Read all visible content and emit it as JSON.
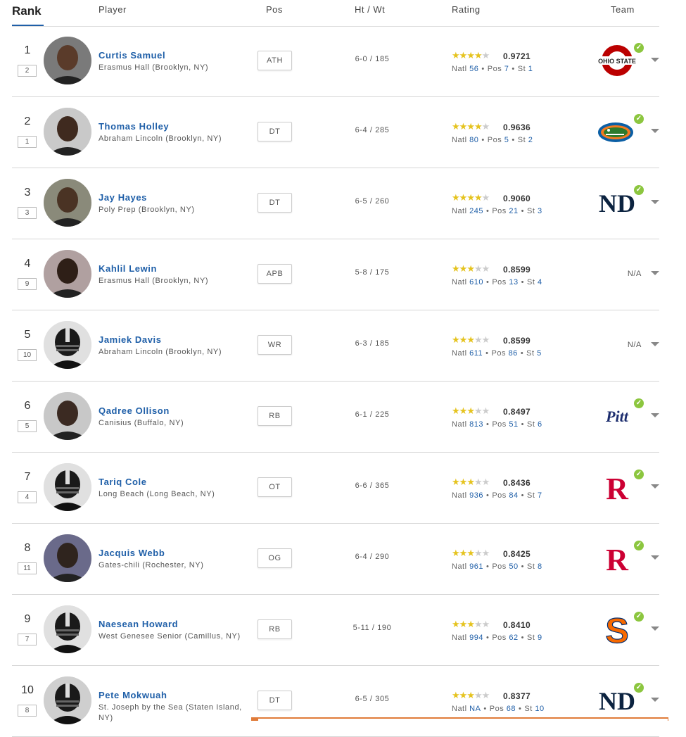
{
  "header": {
    "rank": "Rank",
    "player": "Player",
    "pos": "Pos",
    "htwt": "Ht / Wt",
    "rating": "Rating",
    "team": "Team"
  },
  "colors": {
    "accent": "#1f5fa8",
    "star": "#e5c31e",
    "check": "#8cc63f"
  },
  "players": [
    {
      "rank": "1",
      "prev": "2",
      "name": "Curtis Samuel",
      "school": "Erasmus Hall (Brooklyn, NY)",
      "pos": "ATH",
      "htwt": "6-0 / 185",
      "stars": 4,
      "score": "0.9721",
      "natl_label": "Natl",
      "natl": "56",
      "pos_label": "Pos",
      "posrank": "7",
      "st_label": "St",
      "st": "1",
      "team": "ohio-state-logo",
      "committed": true
    },
    {
      "rank": "2",
      "prev": "1",
      "name": "Thomas Holley",
      "school": "Abraham Lincoln (Brooklyn, NY)",
      "pos": "DT",
      "htwt": "6-4 / 285",
      "stars": 4,
      "score": "0.9636",
      "natl_label": "Natl",
      "natl": "80",
      "pos_label": "Pos",
      "posrank": "5",
      "st_label": "St",
      "st": "2",
      "team": "florida-gator-logo",
      "committed": true
    },
    {
      "rank": "3",
      "prev": "3",
      "name": "Jay Hayes",
      "school": "Poly Prep (Brooklyn, NY)",
      "pos": "DT",
      "htwt": "6-5 / 260",
      "stars": 4,
      "score": "0.9060",
      "natl_label": "Natl",
      "natl": "245",
      "pos_label": "Pos",
      "posrank": "21",
      "st_label": "St",
      "st": "3",
      "team": "notre-dame-logo",
      "committed": true
    },
    {
      "rank": "4",
      "prev": "9",
      "name": "Kahlil Lewin",
      "school": "Erasmus Hall (Brooklyn, NY)",
      "pos": "APB",
      "htwt": "5-8 / 175",
      "stars": 3,
      "score": "0.8599",
      "natl_label": "Natl",
      "natl": "610",
      "pos_label": "Pos",
      "posrank": "13",
      "st_label": "St",
      "st": "4",
      "team": "N/A",
      "committed": false
    },
    {
      "rank": "5",
      "prev": "10",
      "name": "Jamiek Davis",
      "school": "Abraham Lincoln (Brooklyn, NY)",
      "pos": "WR",
      "htwt": "6-3 / 185",
      "stars": 3,
      "score": "0.8599",
      "natl_label": "Natl",
      "natl": "611",
      "pos_label": "Pos",
      "posrank": "86",
      "st_label": "St",
      "st": "5",
      "team": "N/A",
      "committed": false
    },
    {
      "rank": "6",
      "prev": "5",
      "name": "Qadree Ollison",
      "school": "Canisius (Buffalo, NY)",
      "pos": "RB",
      "htwt": "6-1 / 225",
      "stars": 3,
      "score": "0.8497",
      "natl_label": "Natl",
      "natl": "813",
      "pos_label": "Pos",
      "posrank": "51",
      "st_label": "St",
      "st": "6",
      "team": "pitt-logo",
      "team_text": "Pitt",
      "committed": true
    },
    {
      "rank": "7",
      "prev": "4",
      "name": "Tariq Cole",
      "school": "Long Beach (Long Beach, NY)",
      "pos": "OT",
      "htwt": "6-6 / 365",
      "stars": 3,
      "score": "0.8436",
      "natl_label": "Natl",
      "natl": "936",
      "pos_label": "Pos",
      "posrank": "84",
      "st_label": "St",
      "st": "7",
      "team": "rutgers-logo",
      "team_text": "R",
      "committed": true
    },
    {
      "rank": "8",
      "prev": "11",
      "name": "Jacquis Webb",
      "school": "Gates-chili (Rochester, NY)",
      "pos": "OG",
      "htwt": "6-4 / 290",
      "stars": 3,
      "score": "0.8425",
      "natl_label": "Natl",
      "natl": "961",
      "pos_label": "Pos",
      "posrank": "50",
      "st_label": "St",
      "st": "8",
      "team": "rutgers-logo",
      "team_text": "R",
      "committed": true
    },
    {
      "rank": "9",
      "prev": "7",
      "name": "Naesean Howard",
      "school": "West Genesee Senior (Camillus, NY)",
      "pos": "RB",
      "htwt": "5-11 / 190",
      "stars": 3,
      "score": "0.8410",
      "natl_label": "Natl",
      "natl": "994",
      "pos_label": "Pos",
      "posrank": "62",
      "st_label": "St",
      "st": "9",
      "team": "syracuse-logo",
      "team_text": "S",
      "committed": true
    },
    {
      "rank": "10",
      "prev": "8",
      "name": "Pete Mokwuah",
      "school": "St. Joseph by the Sea (Staten Island, NY)",
      "pos": "DT",
      "htwt": "6-5 / 305",
      "stars": 3,
      "score": "0.8377",
      "natl_label": "Natl",
      "natl": "NA",
      "pos_label": "Pos",
      "posrank": "68",
      "st_label": "St",
      "st": "10",
      "team": "notre-dame-logo",
      "committed": true
    }
  ]
}
